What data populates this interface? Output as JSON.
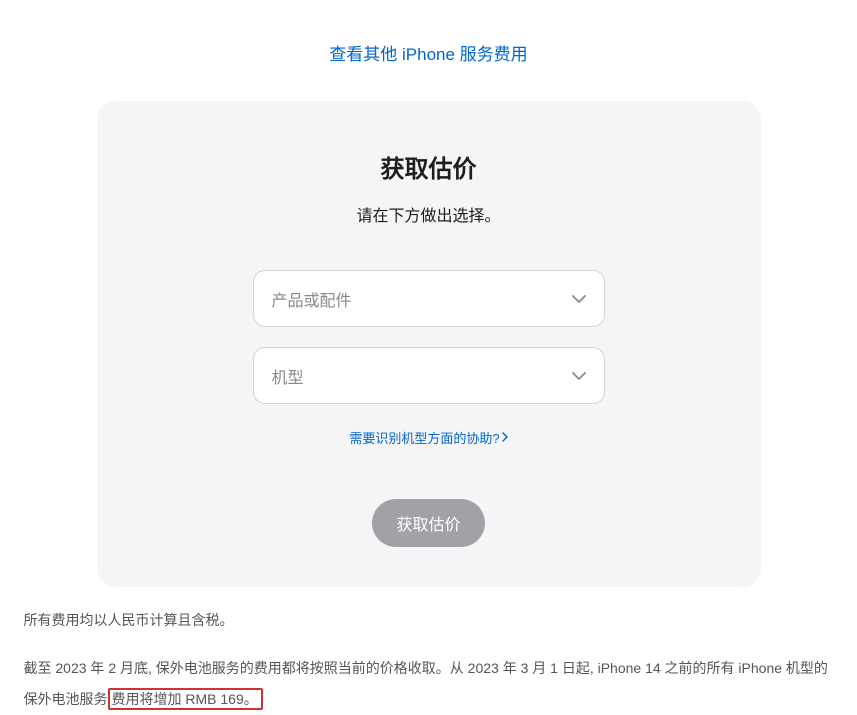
{
  "topLink": "查看其他 iPhone 服务费用",
  "card": {
    "title": "获取估价",
    "subtitle": "请在下方做出选择。",
    "select1": {
      "placeholder": "产品或配件"
    },
    "select2": {
      "placeholder": "机型"
    },
    "helpLink": "需要识别机型方面的协助?",
    "submitLabel": "获取估价"
  },
  "footer": {
    "line1": "所有费用均以人民币计算且含税。",
    "line2_part1": "截至 2023 年 2 月底, 保外电池服务的费用都将按照当前的价格收取。从 2023 年 3 月 1 日起, iPhone 14 之前的所有 iPhone 机型的保外电池服务",
    "line2_highlight": "费用将增加 RMB 169。"
  }
}
